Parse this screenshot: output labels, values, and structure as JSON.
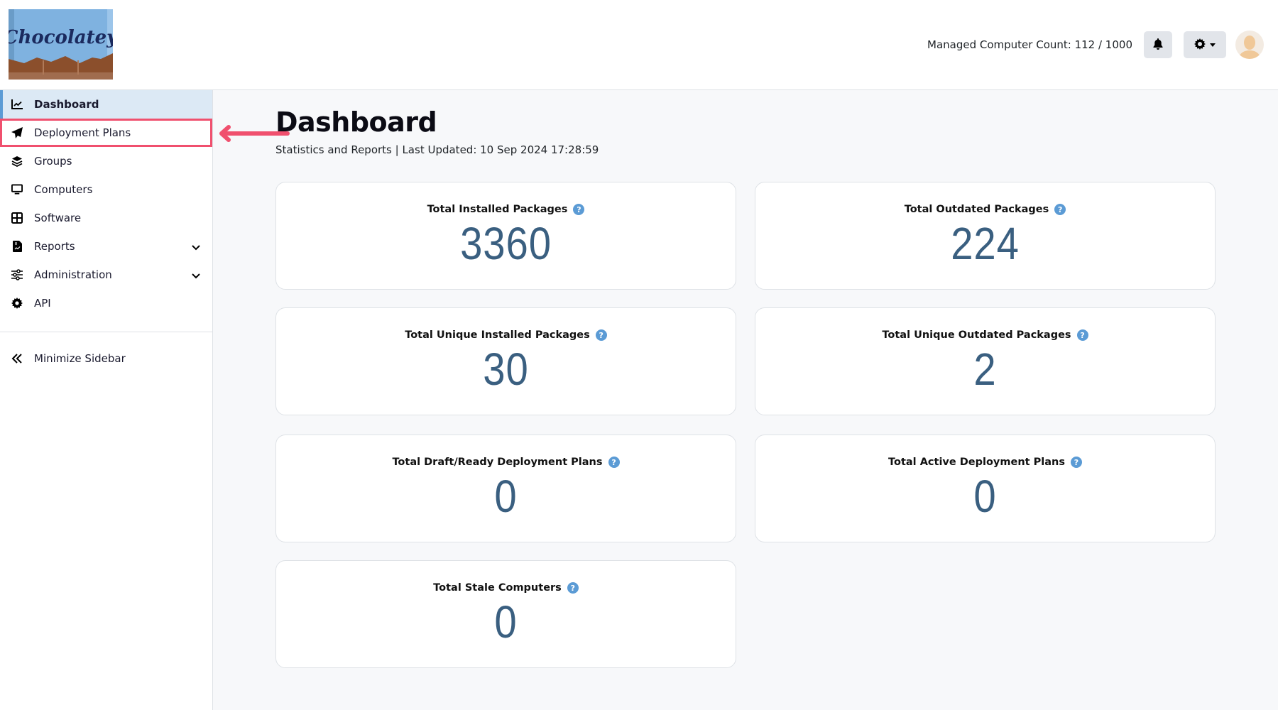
{
  "header": {
    "logo_text": "Chocolatey",
    "managed_count_label": "Managed Computer Count: 112 / 1000",
    "icons": [
      "bell-icon",
      "gear-icon",
      "avatar"
    ]
  },
  "sidebar": {
    "items": [
      {
        "label": "Dashboard",
        "icon": "chart-line-icon",
        "active": true
      },
      {
        "label": "Deployment Plans",
        "icon": "paper-plane-icon",
        "highlighted": true
      },
      {
        "label": "Groups",
        "icon": "layers-icon"
      },
      {
        "label": "Computers",
        "icon": "monitor-icon"
      },
      {
        "label": "Software",
        "icon": "grid-icon"
      },
      {
        "label": "Reports",
        "icon": "file-chart-icon",
        "expandable": true
      },
      {
        "label": "Administration",
        "icon": "sliders-icon",
        "expandable": true
      },
      {
        "label": "API",
        "icon": "cog-icon"
      }
    ],
    "minimize_label": "Minimize Sidebar"
  },
  "main": {
    "title": "Dashboard",
    "subtitle": "Statistics and Reports | Last Updated: 10 Sep 2024 17:28:59",
    "cards": [
      {
        "label": "Total Installed Packages",
        "value": "3360"
      },
      {
        "label": "Total Outdated Packages",
        "value": "224"
      },
      {
        "label": "Total Unique Installed Packages",
        "value": "30"
      },
      {
        "label": "Total Unique Outdated Packages",
        "value": "2"
      },
      {
        "label": "Total Draft/Ready Deployment Plans",
        "value": "0"
      },
      {
        "label": "Total Active Deployment Plans",
        "value": "0"
      },
      {
        "label": "Total Stale Computers",
        "value": "0"
      }
    ],
    "help_glyph": "?"
  },
  "annotation": {
    "arrow_color": "#f0506e"
  }
}
